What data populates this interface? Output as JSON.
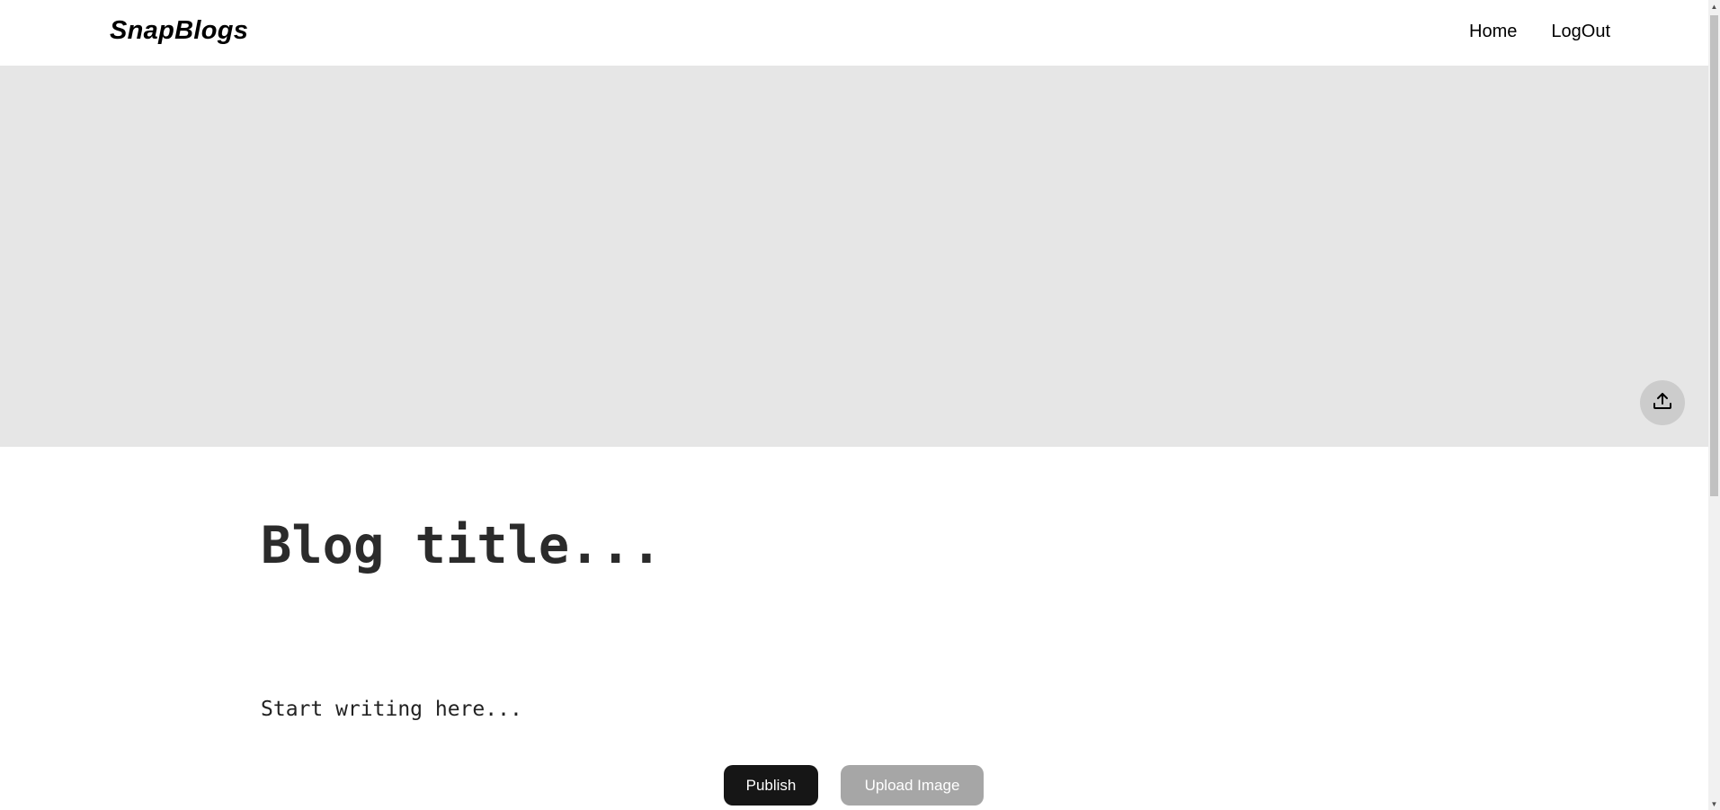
{
  "navbar": {
    "brand": "SnapBlogs",
    "links": [
      {
        "label": "Home"
      },
      {
        "label": "LogOut"
      }
    ]
  },
  "cover": {
    "upload_icon": "upload-icon"
  },
  "editor": {
    "title_placeholder": "Blog title...",
    "body_placeholder": "Start writing here..."
  },
  "actions": {
    "publish_label": "Publish",
    "upload_image_label": "Upload Image"
  },
  "colors": {
    "cover_bg": "#e6e6e6",
    "publish_bg": "#161616",
    "upload_bg": "#a6a6a6",
    "upload_circle_bg": "#cccccc"
  }
}
